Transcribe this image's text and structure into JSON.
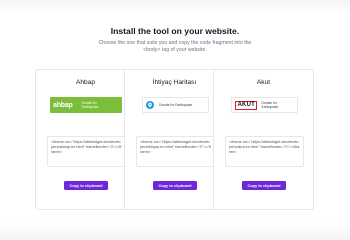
{
  "header": {
    "title": "Install the tool on your website.",
    "subtitle": "Choose the one that suits you and copy the code fragment into the <body> tag of your website."
  },
  "cards": [
    {
      "title": "Ahbap",
      "logo_text": "ahbap",
      "badge_text": "Donate for\nEarthquake",
      "badge_color": "#7cbd3a",
      "code": "<iframe src=\"https://afetwidget.devdevelopers/ahbap.en.html\" frameBorder=\"0\"></iframe>",
      "button_label": "Copy to clipboard"
    },
    {
      "title": "İhtiyaç Haritası",
      "logo_text": "İhtiyaç Haritası",
      "badge_text": "Donate for Earthquake",
      "badge_color": "#ffffff",
      "code": "<iframe src=\"https://afetwidget.devdevelopers/ihtiyac.en.html\" frameBorder=\"0\"></iframe>",
      "button_label": "Copy to clipboard"
    },
    {
      "title": "Akut",
      "logo_text": "AKUT",
      "badge_text": "Donate for\nEarthquake",
      "badge_color": "#ffffff",
      "code": "<iframe src=\"https://afetwidget.devdevelopers/akut.en.html\" frameBorder=\"0\"></iframe>",
      "button_label": "Copy to clipboard"
    }
  ],
  "accent_color": "#6d28d9"
}
